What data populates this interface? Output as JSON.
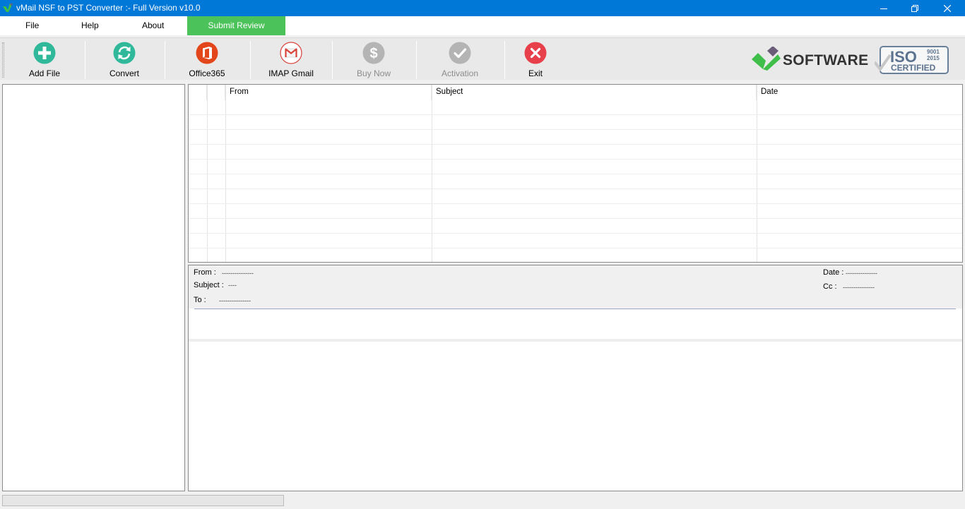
{
  "window": {
    "title": "vMail NSF to PST Converter :- Full Version v10.0",
    "controls": [
      "minimize",
      "maximize",
      "close"
    ]
  },
  "menu": {
    "file": "File",
    "help": "Help",
    "about": "About",
    "submit_review": "Submit Review"
  },
  "toolbar": {
    "add_file": "Add File",
    "convert": "Convert",
    "office365": "Office365",
    "imap_gmail": "IMAP Gmail",
    "buy_now": "Buy Now",
    "activation": "Activation",
    "exit": "Exit",
    "brand": "SOFTWARE",
    "iso": {
      "mark": "ISO",
      "code": "9001",
      "year": "2015",
      "certified": "CERTIFIED"
    }
  },
  "email_list": {
    "columns": [
      "From",
      "Subject",
      "Date"
    ],
    "rows": []
  },
  "preview": {
    "from_label": "From :",
    "from_value": "---------------",
    "subject_label": "Subject :",
    "subject_value": "----",
    "to_label": "To :",
    "to_value": "---------------",
    "date_label": "Date :",
    "date_value": "---------------",
    "cc_label": "Cc :",
    "cc_value": "---------------"
  },
  "colors": {
    "titlebar": "#0078d7",
    "submit_review": "#4cc25a",
    "add_file": "#2fb99a",
    "convert": "#2fb99a",
    "office365": "#e3461b",
    "exit": "#e8404a",
    "disabled": "#b4b4b4"
  }
}
